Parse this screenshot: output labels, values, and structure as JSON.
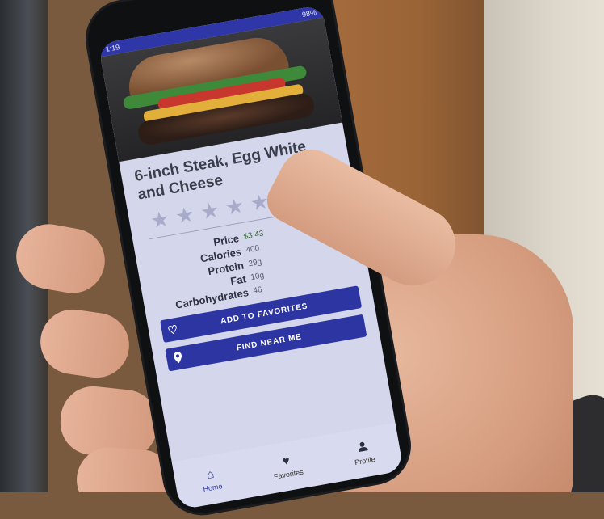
{
  "status_bar": {
    "time": "1:19",
    "battery": "98%"
  },
  "item": {
    "title_line1": "6-inch Steak, Egg White",
    "title_line2": "and Cheese",
    "rating": 0,
    "rating_max": 5
  },
  "nutrition": {
    "price_label": "Price",
    "price_value": "$3.43",
    "calories_label": "Calories",
    "calories_value": "400",
    "protein_label": "Protein",
    "protein_value": "29g",
    "fat_label": "Fat",
    "fat_value": "10g",
    "carbs_label": "Carbohydrates",
    "carbs_value": "46"
  },
  "actions": {
    "favorites_label": "ADD TO FAVORITES",
    "find_label": "FIND NEAR ME"
  },
  "nav": {
    "home": "Home",
    "favorites": "Favorites",
    "profile": "Profile"
  },
  "colors": {
    "app_bar": "#2f37a8",
    "button": "#2d35a2",
    "screen_bg": "#d4d7ec",
    "star_empty": "#a7aac9"
  },
  "icons": {
    "favorites_button": "heart-outline-icon",
    "find_button": "map-pin-icon",
    "nav_home": "home-icon",
    "nav_favorites": "heart-icon",
    "nav_profile": "person-icon"
  }
}
